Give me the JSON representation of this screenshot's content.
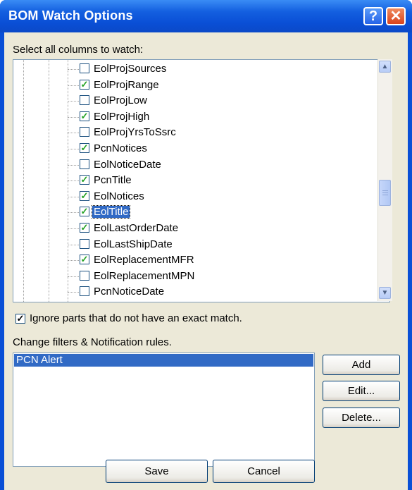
{
  "window": {
    "title": "BOM Watch Options",
    "help_glyph": "?",
    "close_glyph": "✕"
  },
  "columns": {
    "label": "Select all columns to watch:",
    "items": [
      {
        "label": "EolProjSources",
        "checked": false
      },
      {
        "label": "EolProjRange",
        "checked": true
      },
      {
        "label": "EolProjLow",
        "checked": false
      },
      {
        "label": "EolProjHigh",
        "checked": true
      },
      {
        "label": "EolProjYrsToSsrc",
        "checked": false
      },
      {
        "label": "PcnNotices",
        "checked": true
      },
      {
        "label": "EolNoticeDate",
        "checked": false
      },
      {
        "label": "PcnTitle",
        "checked": true
      },
      {
        "label": "EolNotices",
        "checked": true
      },
      {
        "label": "EolTitle",
        "checked": true,
        "selected": true
      },
      {
        "label": "EolLastOrderDate",
        "checked": true
      },
      {
        "label": "EolLastShipDate",
        "checked": false
      },
      {
        "label": "EolReplacementMFR",
        "checked": true
      },
      {
        "label": "EolReplacementMPN",
        "checked": false
      },
      {
        "label": "PcnNoticeDate",
        "checked": false
      }
    ],
    "scroll_up_glyph": "▲",
    "scroll_down_glyph": "▼"
  },
  "ignore_option": {
    "label": "Ignore parts that do not have an exact match.",
    "checked": true,
    "check_glyph": "✓"
  },
  "rules": {
    "label": "Change filters & Notification rules.",
    "items": [
      "PCN Alert"
    ],
    "add_label": "Add",
    "edit_label": "Edit...",
    "delete_label": "Delete..."
  },
  "footer": {
    "save_label": "Save",
    "cancel_label": "Cancel"
  },
  "colors": {
    "title_bar": "#0a4fd6",
    "selection": "#316ac5",
    "dialog_bg": "#ece9d8",
    "check": "#21a121"
  }
}
